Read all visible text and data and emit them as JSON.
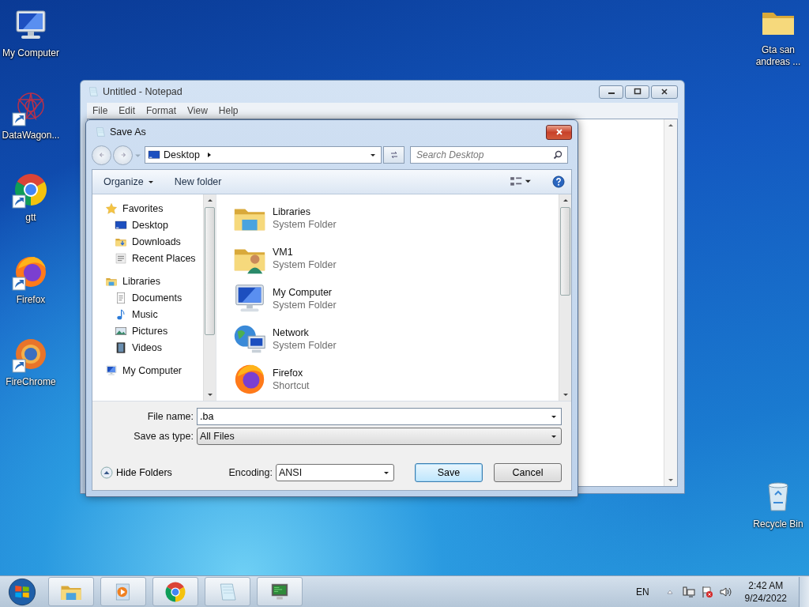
{
  "desktop": {
    "left_icons": [
      {
        "label": "My Computer",
        "kind": "computer",
        "shortcut": false
      },
      {
        "label": "DataWagon...",
        "kind": "web",
        "shortcut": true
      },
      {
        "label": "gtt",
        "kind": "chrome",
        "shortcut": true
      },
      {
        "label": "Firefox",
        "kind": "firefox",
        "shortcut": true
      },
      {
        "label": "FireChrome",
        "kind": "firechrome",
        "shortcut": true
      }
    ],
    "right_icons": [
      {
        "label": "Gta san andreas ...",
        "kind": "folder",
        "shortcut": false
      },
      {
        "label": "Recycle Bin",
        "kind": "bin",
        "shortcut": false
      }
    ]
  },
  "notepad": {
    "title": "Untitled - Notepad",
    "menu": [
      "File",
      "Edit",
      "Format",
      "View",
      "Help"
    ]
  },
  "save_dialog": {
    "title": "Save As",
    "address": "Desktop",
    "search_placeholder": "Search Desktop",
    "toolbar": {
      "organize": "Organize",
      "new_folder": "New folder"
    },
    "nav_pane": [
      {
        "label": "Favorites",
        "kind": "star",
        "children": [
          {
            "label": "Desktop",
            "kind": "desktop"
          },
          {
            "label": "Downloads",
            "kind": "downloads"
          },
          {
            "label": "Recent Places",
            "kind": "recent"
          }
        ]
      },
      {
        "label": "Libraries",
        "kind": "libraries",
        "children": [
          {
            "label": "Documents",
            "kind": "document"
          },
          {
            "label": "Music",
            "kind": "music"
          },
          {
            "label": "Pictures",
            "kind": "pictures"
          },
          {
            "label": "Videos",
            "kind": "videos"
          }
        ]
      },
      {
        "label": "My Computer",
        "kind": "computer"
      }
    ],
    "files": [
      {
        "name": "Libraries",
        "type": "System Folder",
        "kind": "libraries"
      },
      {
        "name": "VM1",
        "type": "System Folder",
        "kind": "user"
      },
      {
        "name": "My Computer",
        "type": "System Folder",
        "kind": "computer"
      },
      {
        "name": "Network",
        "type": "System Folder",
        "kind": "network"
      },
      {
        "name": "Firefox",
        "type": "Shortcut",
        "kind": "firefox"
      }
    ],
    "file_name": {
      "label": "File name:",
      "value": ".ba"
    },
    "save_as_type": {
      "label": "Save as type:",
      "value": "All Files"
    },
    "hide_folders": "Hide Folders",
    "encoding": {
      "label": "Encoding:",
      "value": "ANSI"
    },
    "buttons": [
      {
        "label": "Save",
        "default": true
      },
      {
        "label": "Cancel",
        "default": false
      }
    ]
  },
  "taskbar": {
    "buttons": [
      {
        "kind": "libraries"
      },
      {
        "kind": "media"
      },
      {
        "kind": "chrome"
      },
      {
        "kind": "notepad"
      },
      {
        "kind": "monitor"
      }
    ],
    "language": "EN",
    "time": "2:42 AM",
    "date": "9/24/2022"
  }
}
